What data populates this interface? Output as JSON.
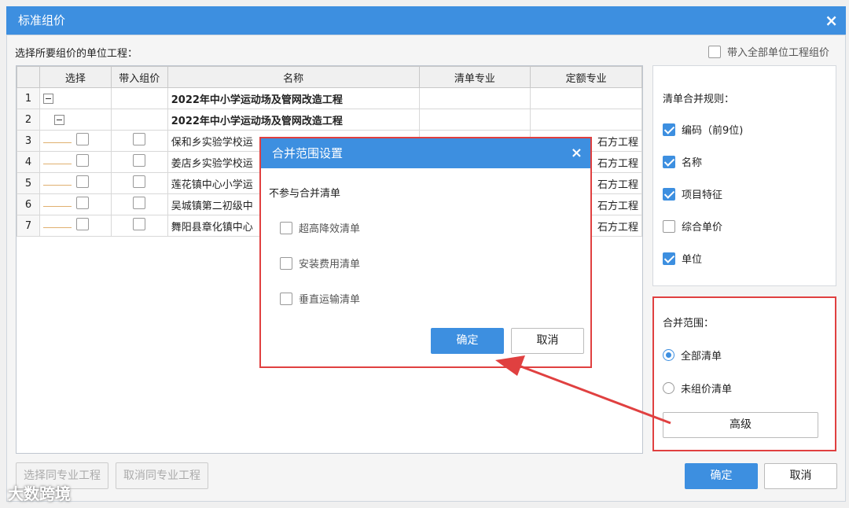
{
  "window": {
    "title": "标准组价",
    "close_icon": "close-icon"
  },
  "header": {
    "label": "选择所要组价的单位工程：",
    "bring_all_label": "带入全部单位工程组价",
    "bring_all_checked": false
  },
  "table": {
    "columns": [
      "选择",
      "带入组价",
      "名称",
      "清单专业",
      "定额专业"
    ],
    "rows": [
      {
        "num": "1",
        "name": "2022年中小学运动场及管网改造工程",
        "qd": "",
        "de": ""
      },
      {
        "num": "2",
        "name": "2022年中小学运动场及管网改造工程",
        "qd": "",
        "de": ""
      },
      {
        "num": "3",
        "name": "保和乡实验学校运",
        "qd": "",
        "de": "石方工程"
      },
      {
        "num": "4",
        "name": "姜店乡实验学校运",
        "qd": "",
        "de": "石方工程"
      },
      {
        "num": "5",
        "name": "莲花镇中心小学运",
        "qd": "",
        "de": "石方工程"
      },
      {
        "num": "6",
        "name": "吴城镇第二初级中",
        "qd": "",
        "de": "石方工程"
      },
      {
        "num": "7",
        "name": "舞阳县章化镇中心",
        "qd": "",
        "de": "石方工程"
      }
    ]
  },
  "rules": {
    "title": "清单合并规则：",
    "items": [
      {
        "label": "编码（前9位)",
        "checked": true
      },
      {
        "label": "名称",
        "checked": true
      },
      {
        "label": "项目特征",
        "checked": true
      },
      {
        "label": "综合单价",
        "checked": false
      },
      {
        "label": "单位",
        "checked": true
      }
    ]
  },
  "scope": {
    "title": "合并范围：",
    "options": [
      {
        "label": "全部清单",
        "selected": true
      },
      {
        "label": "未组价清单",
        "selected": false
      }
    ],
    "advanced_label": "高级"
  },
  "footer": {
    "select_same_label": "选择同专业工程",
    "cancel_same_label": "取消同专业工程",
    "ok_label": "确定",
    "cancel_label": "取消"
  },
  "modal": {
    "title": "合并范围设置",
    "section_label": "不参与合并清单",
    "options": [
      {
        "label": "超高降效清单",
        "checked": false
      },
      {
        "label": "安装费用清单",
        "checked": false
      },
      {
        "label": "垂直运输清单",
        "checked": false
      }
    ],
    "ok_label": "确定",
    "cancel_label": "取消"
  },
  "watermark": {
    "text": "大数跨境"
  },
  "colors": {
    "accent": "#3d8fe0",
    "highlight": "#e04040"
  }
}
